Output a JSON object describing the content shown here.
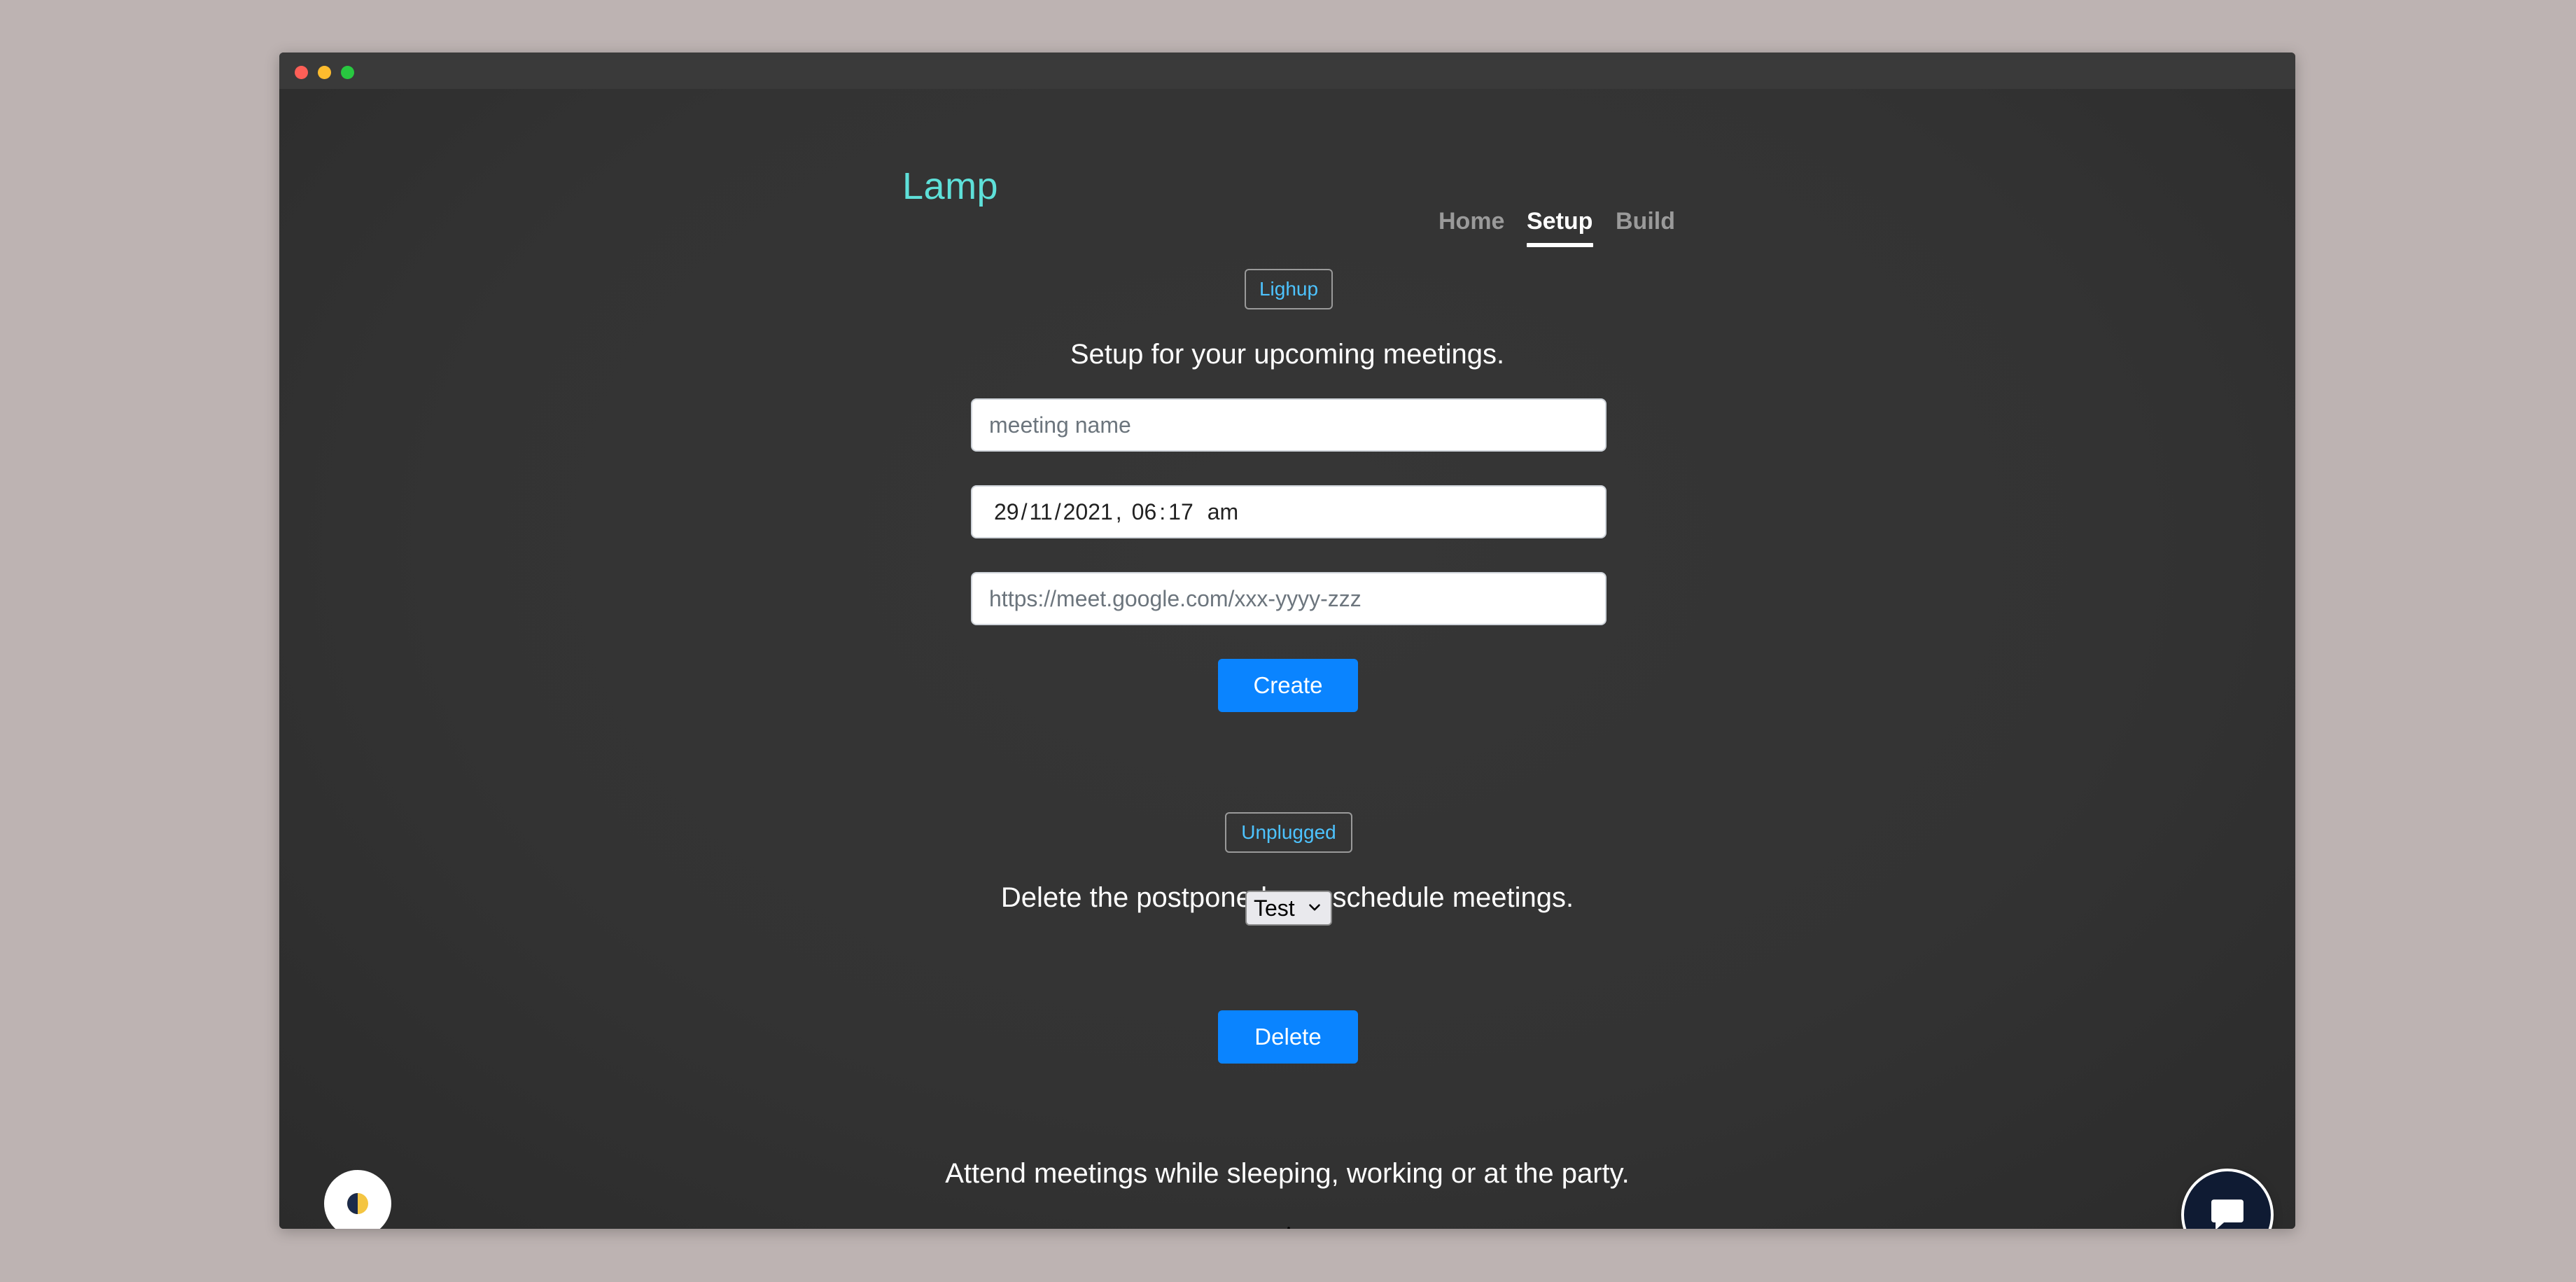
{
  "app": {
    "brand": "Lamp"
  },
  "nav": {
    "home": "Home",
    "setup": "Setup",
    "build": "Build"
  },
  "setup_section": {
    "badge": "Lighup",
    "heading": "Setup for your upcoming meetings.",
    "meeting_name_placeholder": "meeting name",
    "datetime": {
      "day": "29",
      "month": "11",
      "year": "2021",
      "hour": "06",
      "minute": "17",
      "ampm": "am"
    },
    "link_placeholder": "https://meet.google.com/xxx-yyyy-zzz",
    "create_label": "Create"
  },
  "delete_section": {
    "badge": "Unplugged",
    "heading": "Delete the postponed or reschedule meetings.",
    "selected_meeting": "Test",
    "delete_label": "Delete"
  },
  "footer_text": "Attend meetings while sleeping, working or at the party.",
  "icons": {
    "theme_toggle": "contrast-icon",
    "chat": "chat-bubble-icon",
    "scroll_down": "arrow-down-circle-icon",
    "select_chevron": "chevron-down-icon"
  },
  "colors": {
    "brand": "#5ee0d9",
    "badge_text": "#4dc3ff",
    "primary_button": "#0a84ff",
    "background": "#333333"
  }
}
